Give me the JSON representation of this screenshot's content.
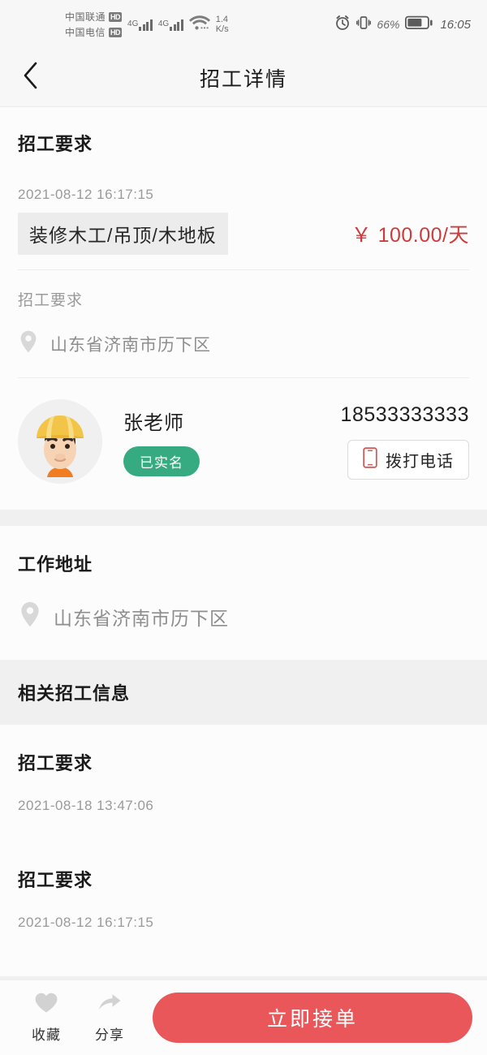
{
  "statusbar": {
    "carrier1": "中国联通",
    "carrier2": "中国电信",
    "hd_badge": "HD",
    "network1": "4G",
    "network2": "4G",
    "speed_value": "1.4",
    "speed_unit": "K/s",
    "battery_percent": "66%",
    "time": "16:05",
    "icons": [
      "alarm-icon",
      "vibrate-icon",
      "wifi-icon",
      "battery-icon"
    ]
  },
  "navbar": {
    "title": "招工详情",
    "back_icon": "chevron-left-icon"
  },
  "job": {
    "section_title": "招工要求",
    "posted_at": "2021-08-12 16:17:15",
    "tag": "装修木工/吊顶/木地板",
    "price": "￥ 100.00/天",
    "requirement_label": "招工要求",
    "location": "山东省济南市历下区",
    "location_icon": "location-pin-icon"
  },
  "contact": {
    "avatar_icon": "worker-avatar",
    "name": "张老师",
    "verified_badge": "已实名",
    "phone": "18533333333",
    "call_button": "拨打电话",
    "call_icon": "mobile-phone-icon"
  },
  "work_address": {
    "section_title": "工作地址",
    "location": "山东省济南市历下区",
    "location_icon": "location-pin-icon"
  },
  "related": {
    "section_title": "相关招工信息",
    "items": [
      {
        "title": "招工要求",
        "posted_at": "2021-08-18 13:47:06"
      },
      {
        "title": "招工要求",
        "posted_at": "2021-08-12 16:17:15"
      }
    ]
  },
  "bottombar": {
    "favorite_label": "收藏",
    "favorite_icon": "heart-icon",
    "share_label": "分享",
    "share_icon": "share-arrow-icon",
    "cta_label": "立即接单"
  },
  "colors": {
    "price_red": "#cc3c3c",
    "cta_red": "#e9575a",
    "verified_green": "#36ab81",
    "tag_bg": "#ececec",
    "page_bg": "#f0f0f0"
  }
}
